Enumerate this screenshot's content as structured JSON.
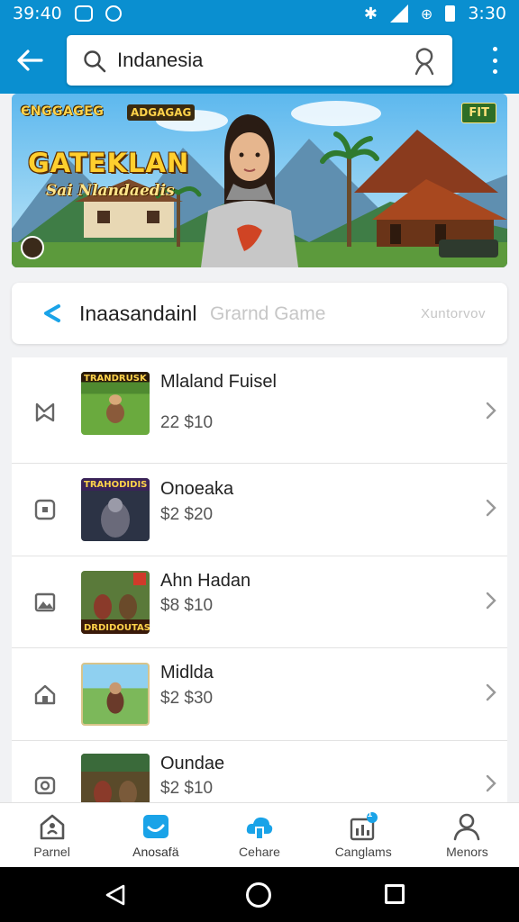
{
  "status_bar": {
    "time_left": "39:40",
    "time_right": "3:30"
  },
  "search": {
    "value": "Indanesia"
  },
  "banner": {
    "publisher": "ЄNGGAGEG",
    "tag": "ADGAGAG",
    "title": "GATEKLAN",
    "subtitle": "Sai Nlandaedis",
    "badge": "FIT"
  },
  "category": {
    "name": "Inaasandainl",
    "hint": "Grarnd Game",
    "filter": "Xuntorvov"
  },
  "games": [
    {
      "title": "Mlaland Fuisel",
      "price": "22 $10",
      "type_icon": "tag-icon",
      "thumb_label": "TRANDRUSK"
    },
    {
      "title": "Onoeaka",
      "price": "$2 $20",
      "type_icon": "square-icon",
      "thumb_label": "TRAHODIDIS"
    },
    {
      "title": "Ahn Hadan",
      "price": "$8 $10",
      "type_icon": "image-icon",
      "thumb_label": "DRDIDOUTAS"
    },
    {
      "title": "Midlda",
      "price": "$2 $30",
      "type_icon": "home-icon",
      "thumb_label": ""
    },
    {
      "title": "Oundae",
      "price": "$2 $10",
      "type_icon": "camera-icon",
      "thumb_label": ""
    }
  ],
  "bottom_nav": [
    {
      "label": "Parnel",
      "icon": "home-icon"
    },
    {
      "label": "Anosafä",
      "icon": "chat-icon",
      "active": true
    },
    {
      "label": "Cehare",
      "icon": "cloud-icon"
    },
    {
      "label": "Canglams",
      "icon": "chart-icon",
      "badge": "1"
    },
    {
      "label": "Menors",
      "icon": "person-icon"
    }
  ],
  "colors": {
    "accent": "#0a8fd0",
    "active_nav": "#1aa3e8"
  }
}
